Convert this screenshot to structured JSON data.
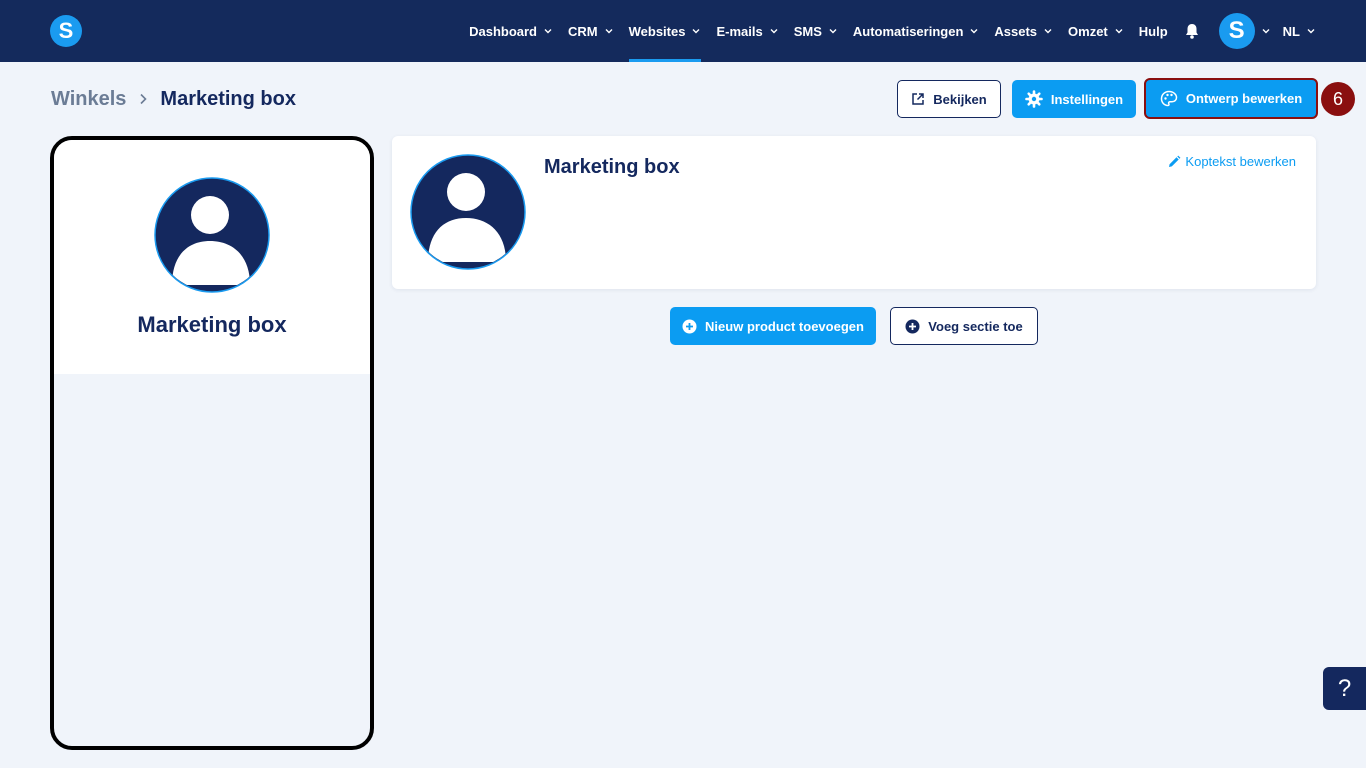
{
  "app": {
    "logo_letter": "S"
  },
  "nav": {
    "items": [
      {
        "label": "Dashboard",
        "has_dropdown": true,
        "active": false
      },
      {
        "label": "CRM",
        "has_dropdown": true,
        "active": false
      },
      {
        "label": "Websites",
        "has_dropdown": true,
        "active": true
      },
      {
        "label": "E-mails",
        "has_dropdown": true,
        "active": false
      },
      {
        "label": "SMS",
        "has_dropdown": true,
        "active": false
      },
      {
        "label": "Automatiseringen",
        "has_dropdown": true,
        "active": false
      },
      {
        "label": "Assets",
        "has_dropdown": true,
        "active": false
      },
      {
        "label": "Omzet",
        "has_dropdown": true,
        "active": false
      },
      {
        "label": "Hulp",
        "has_dropdown": false,
        "active": false
      }
    ],
    "notification_icon": "bell-icon",
    "user_avatar_letter": "S",
    "language": "NL"
  },
  "breadcrumb": {
    "parent": "Winkels",
    "current": "Marketing box"
  },
  "toolbar": {
    "view_label": "Bekijken",
    "settings_label": "Instellingen",
    "edit_design_label": "Ontwerp bewerken",
    "step_number": "6"
  },
  "preview": {
    "store_name": "Marketing box"
  },
  "header_card": {
    "store_name": "Marketing box",
    "edit_header_label": "Koptekst bewerken"
  },
  "actions": {
    "add_product_label": "Nieuw product toevoegen",
    "add_section_label": "Voeg sectie toe"
  },
  "help": {
    "label": "?"
  },
  "colors": {
    "navbar": "#142a5c",
    "accent": "#0b9cf2",
    "brand_dark": "#14285e",
    "highlight": "#8a0f0f",
    "background": "#f0f4fa"
  }
}
